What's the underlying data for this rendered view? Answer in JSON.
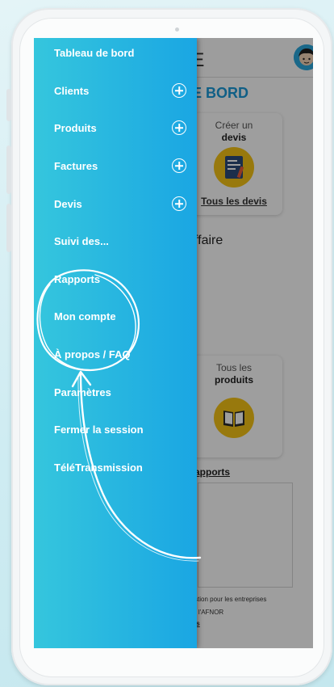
{
  "app": {
    "title_partial": "IIE",
    "dashboard_title_partial": "E BORD",
    "cards": {
      "devis": {
        "line1": "Créer un",
        "line2": "devis",
        "link": "Tous les devis"
      },
      "produits": {
        "line1": "Tous les",
        "line2": "produits"
      }
    },
    "affaire_partial": "ffaire",
    "rapports_link_partial": "apports",
    "footer": {
      "line1": "stion pour les entreprises",
      "line2": "r l'AFNOR",
      "line3": "is"
    }
  },
  "drawer": {
    "items": [
      {
        "label": "Tableau de bord",
        "expandable": false
      },
      {
        "label": "Clients",
        "expandable": true
      },
      {
        "label": "Produits",
        "expandable": true
      },
      {
        "label": "Factures",
        "expandable": true
      },
      {
        "label": "Devis",
        "expandable": true
      },
      {
        "label": "Suivi des...",
        "expandable": false
      },
      {
        "label": "Rapports",
        "expandable": false
      },
      {
        "label": "Mon compte",
        "expandable": false
      },
      {
        "label": "À propos / FAQ",
        "expandable": false
      },
      {
        "label": "Paramètres",
        "expandable": false
      },
      {
        "label": "Fermer la session",
        "expandable": false
      },
      {
        "label": "TéléTransmission",
        "expandable": false
      }
    ],
    "highlighted_item": "Mon compte"
  },
  "colors": {
    "drawer_start": "#35c6dd",
    "drawer_end": "#1aa6e3",
    "accent": "#1a9ad8",
    "icon_yellow": "#f5c416"
  }
}
